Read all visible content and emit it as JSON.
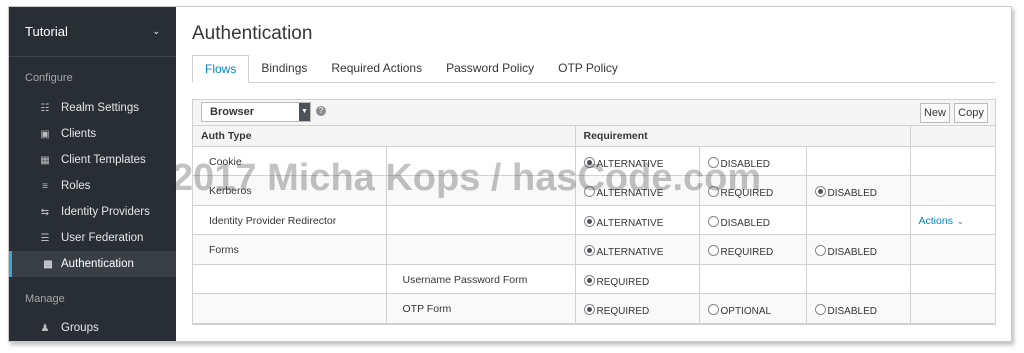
{
  "sidebar": {
    "realm": "Tutorial",
    "configure_label": "Configure",
    "manage_label": "Manage",
    "configure_items": [
      {
        "label": "Realm Settings",
        "icon": "sliders-icon"
      },
      {
        "label": "Clients",
        "icon": "cube-icon"
      },
      {
        "label": "Client Templates",
        "icon": "cubes-icon"
      },
      {
        "label": "Roles",
        "icon": "list-icon"
      },
      {
        "label": "Identity Providers",
        "icon": "exchange-icon"
      },
      {
        "label": "User Federation",
        "icon": "database-icon"
      },
      {
        "label": "Authentication",
        "icon": "lock-icon"
      }
    ],
    "manage_items": [
      {
        "label": "Groups",
        "icon": "users-icon"
      }
    ]
  },
  "page": {
    "title": "Authentication",
    "tabs": [
      "Flows",
      "Bindings",
      "Required Actions",
      "Password Policy",
      "OTP Policy"
    ],
    "active_tab": "Flows"
  },
  "toolbar": {
    "flow_select": "Browser",
    "help_icon": "?",
    "new_label": "New",
    "copy_label": "Copy"
  },
  "table": {
    "headers": [
      "Auth Type",
      "Requirement"
    ],
    "rows": [
      {
        "name": "Cookie",
        "sub": "",
        "options": [
          "ALTERNATIVE",
          "DISABLED",
          ""
        ],
        "selected": 0,
        "actions": ""
      },
      {
        "name": "Kerberos",
        "sub": "",
        "options": [
          "ALTERNATIVE",
          "REQUIRED",
          "DISABLED"
        ],
        "selected": 2,
        "actions": ""
      },
      {
        "name": "Identity Provider Redirector",
        "sub": "",
        "options": [
          "ALTERNATIVE",
          "DISABLED",
          ""
        ],
        "selected": 0,
        "actions": "Actions"
      },
      {
        "name": "Forms",
        "sub": "",
        "options": [
          "ALTERNATIVE",
          "REQUIRED",
          "DISABLED"
        ],
        "selected": 0,
        "actions": ""
      },
      {
        "name": "",
        "sub": "Username Password Form",
        "options": [
          "REQUIRED",
          "",
          ""
        ],
        "selected": 0,
        "actions": ""
      },
      {
        "name": "",
        "sub": "OTP Form",
        "options": [
          "REQUIRED",
          "OPTIONAL",
          "DISABLED"
        ],
        "selected": 0,
        "actions": ""
      }
    ]
  },
  "watermark": "2017 Micha Kops / hasCode.com",
  "colors": {
    "sidebar_bg": "#292e34",
    "accent": "#39a5dc",
    "link": "#0088ce"
  }
}
